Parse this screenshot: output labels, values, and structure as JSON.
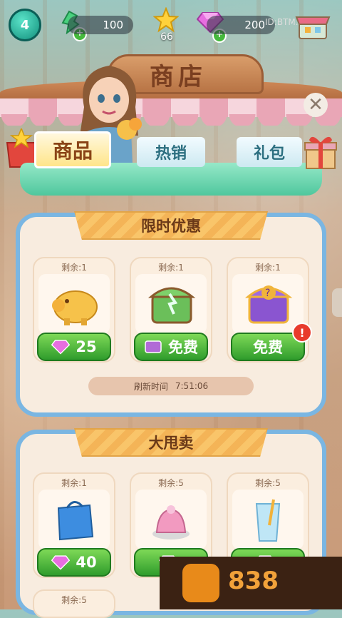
{
  "topbar": {
    "level": "4",
    "energy": "100",
    "stars": "66",
    "gems": "200",
    "id_label": "ID:BTM..."
  },
  "header": {
    "title": "商店"
  },
  "tabs": [
    {
      "label": "商品",
      "active": true
    },
    {
      "label": "热销",
      "active": false
    },
    {
      "label": "礼包",
      "active": false
    }
  ],
  "limited": {
    "title": "限时优惠",
    "items": [
      {
        "stock": "剩余:1",
        "item": "piggy-bank",
        "price_type": "gem",
        "price": "25"
      },
      {
        "stock": "剩余:1",
        "item": "green-chest",
        "price_type": "free",
        "price": "免费"
      },
      {
        "stock": "剩余:1",
        "item": "purple-mystery-chest",
        "price_type": "free",
        "price": "免费"
      }
    ],
    "refresh_label": "刷新时间",
    "refresh_time": "7:51:06"
  },
  "clearance": {
    "title": "大甩卖",
    "items": [
      {
        "stock": "剩余:1",
        "item": "blue-bag",
        "price_type": "gem",
        "price": "40"
      },
      {
        "stock": "剩余:5",
        "item": "pink-pudding",
        "price_type": "gem",
        "price": ""
      },
      {
        "stock": "剩余:5",
        "item": "water-glass",
        "price_type": "gem",
        "price": ""
      }
    ],
    "next_row_stock": "剩余:5"
  },
  "watermark": {
    "text": "838"
  },
  "colors": {
    "accent_green": "#2f9c2c",
    "panel_border": "#7ab6e2",
    "ribbon": "#f9c56a"
  }
}
